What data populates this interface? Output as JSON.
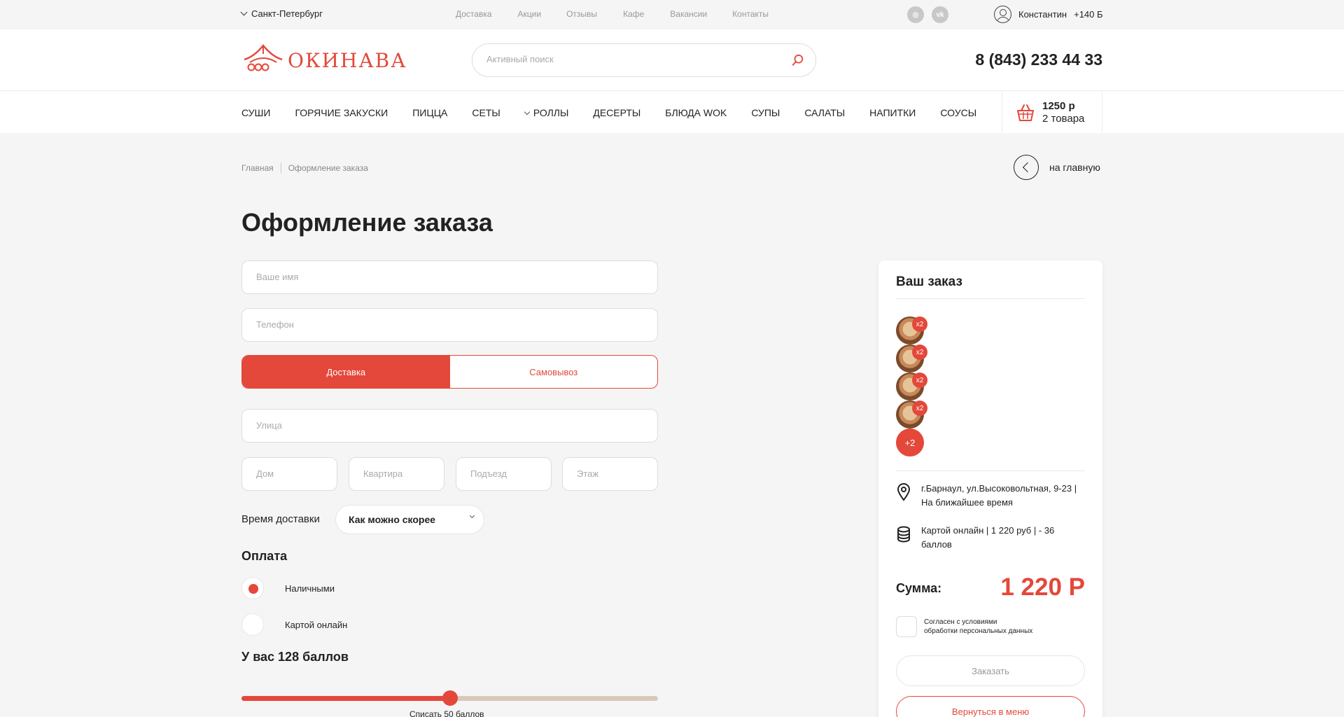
{
  "topbar": {
    "city": "Санкт-Петербург",
    "nav": [
      "Доставка",
      "Акции",
      "Отзывы",
      "Кафе",
      "Вакансии",
      "Контакты"
    ],
    "social": [
      {
        "icon": "instagram-icon",
        "glyph": "◎"
      },
      {
        "icon": "vk-icon",
        "glyph": "vk"
      }
    ],
    "user_name": "Константин",
    "user_points": "+140 Б"
  },
  "header": {
    "logo_text": "ОКИНАВА",
    "search_placeholder": "Активный поиск",
    "phone": "8 (843) 233 44 33"
  },
  "menu": {
    "items": [
      "Суши",
      "Горячие закуски",
      "Пицца",
      "Сеты",
      "Роллы",
      "Десерты",
      "Блюда WOK",
      "Супы",
      "Салаты",
      "Напитки",
      "Соусы"
    ],
    "cart_price": "1250 р",
    "cart_count": "2 товара"
  },
  "breadcrumb": [
    "Главная",
    "Оформление заказа"
  ],
  "back_label": "на главную",
  "page_title": "Оформление заказа",
  "form": {
    "name_placeholder": "Ваше имя",
    "phone_placeholder": "Телефон",
    "delivery_label": "Доставка",
    "pickup_label": "Самовывоз",
    "street_placeholder": "Улица",
    "house_placeholder": "Дом",
    "flat_placeholder": "Квартира",
    "entrance_placeholder": "Подъезд",
    "floor_placeholder": "Этаж",
    "time_label": "Время доставки",
    "time_value": "Как можно скорее",
    "payment_title": "Оплата",
    "pay_cash": "Наличными",
    "pay_card": "Картой онлайн",
    "points_title": "У вас 128 баллов",
    "slider_fraction": 0.5,
    "slider_label": "Списать 50 баллов"
  },
  "order": {
    "title": "Ваш заказ",
    "items": [
      {
        "qty": "x2"
      },
      {
        "qty": "x2"
      },
      {
        "qty": "x2"
      },
      {
        "qty": "x2"
      }
    ],
    "more": "+2",
    "address": "г.Барнаул, ул.Высоковольтная, 9-23 | На ближайшее время",
    "payment": "Картой онлайн | 1 220 руб | - 36 баллов",
    "sum_label": "Сумма:",
    "sum_value": "1 220 Р",
    "agree_line1": "Согласен с условиями",
    "agree_line2": "обработки персональных данных",
    "order_button": "Заказать",
    "back_button": "Вернуться в меню"
  },
  "colors": {
    "accent": "#e3483a",
    "background": "#f5f5f5"
  }
}
